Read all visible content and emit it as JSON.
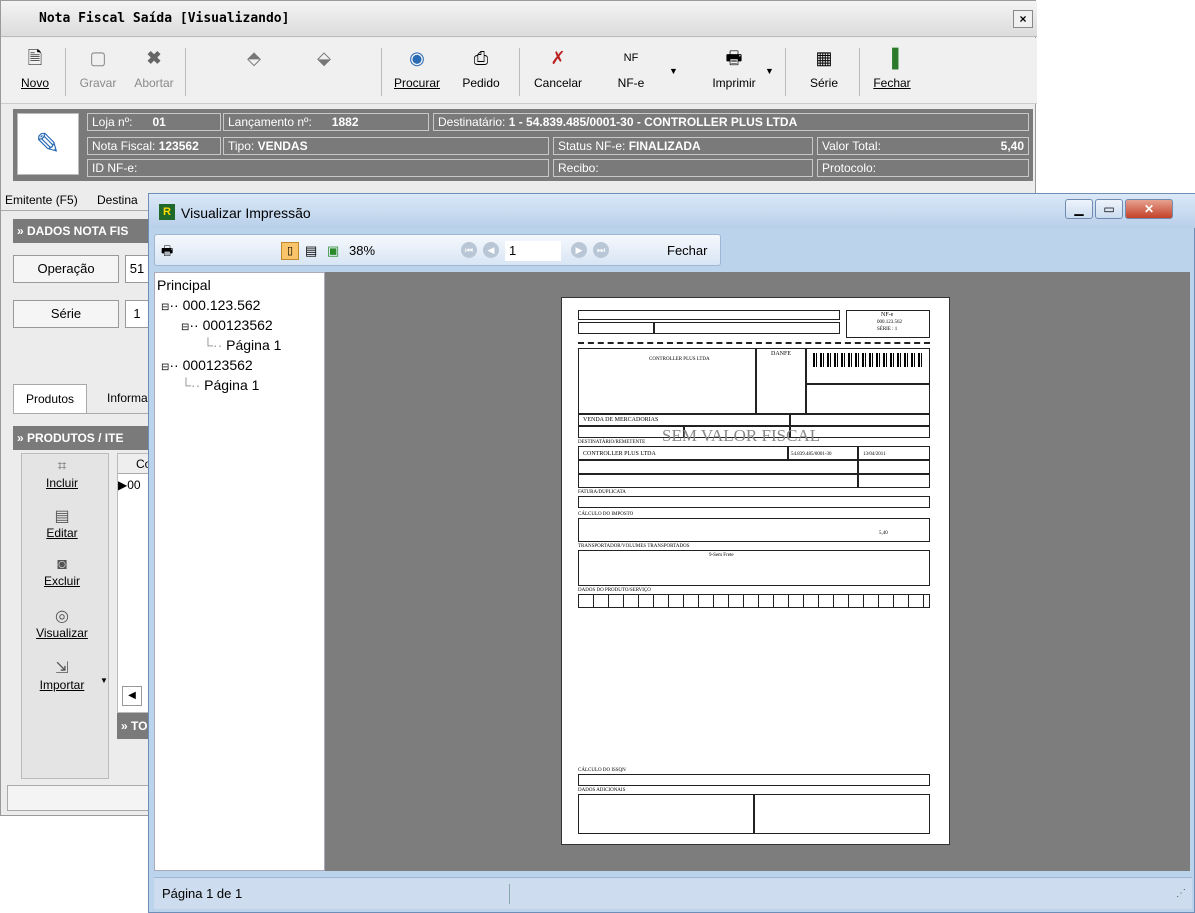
{
  "bg_window": {
    "title": "Nota Fiscal Saída [Visualizando]",
    "close": "×",
    "toolbar": {
      "novo": "Novo",
      "gravar": "Gravar",
      "abortar": "Abortar",
      "procurar": "Procurar",
      "pedido": "Pedido",
      "cancelar": "Cancelar",
      "nfe": "NF-e",
      "imprimir": "Imprimir",
      "serie": "Série",
      "fechar": "Fechar"
    },
    "header": {
      "loja_label": "Loja nº:",
      "loja_value": "01",
      "lanc_label": "Lançamento nº:",
      "lanc_value": "1882",
      "dest_label": "Destinatário:",
      "dest_value": "1 - 54.839.485/0001-30 - CONTROLLER PLUS LTDA",
      "nota_label": "Nota Fiscal:",
      "nota_value": "123562",
      "tipo_label": "Tipo:",
      "tipo_value": "VENDAS",
      "status_label": "Status NF-e:",
      "status_value": "FINALIZADA",
      "valor_label": "Valor Total:",
      "valor_value": "5,40",
      "idnfe_label": "ID NF-e:",
      "recibo_label": "Recibo:",
      "protocolo_label": "Protocolo:"
    },
    "tabs": [
      "Emitente (F5)",
      "Destina"
    ],
    "dados_title": "» DADOS NOTA FIS",
    "operacao": "Operação",
    "operacao_val": "51",
    "serie": "Série",
    "serie_val": "1",
    "subtabs": [
      "Produtos",
      "Informa"
    ],
    "produtos_title": "» PRODUTOS / ITE",
    "actions": {
      "incluir": "Incluir",
      "editar": "Editar",
      "excluir": "Excluir",
      "visualizar": "Visualizar",
      "importar": "Importar"
    },
    "grid_col": "Co",
    "grid_row": "00",
    "totals_title": "» TO"
  },
  "preview_window": {
    "title": "Visualizar Impressão",
    "zoom": "38%",
    "page_num": "1",
    "close_label": "Fechar",
    "tree": [
      "Principal",
      "000.123.562",
      "000123562",
      "Página 1",
      "000123562",
      "Página 1"
    ],
    "status": "Página 1 de 1",
    "document": {
      "watermark": "SEM VALOR FISCAL",
      "danfe": "DANFE",
      "nfe_label": "NF-e",
      "nfe_number": "000.123.562",
      "serie": "SÉRIE : 1",
      "emit_name": "CONTROLLER PLUS LTDA",
      "natureza": "VENDA DE MERCADORIAS",
      "dest_name": "CONTROLLER PLUS LTDA",
      "section_dest": "DESTINATÁRIO/REMETENTE",
      "section_fatura": "FATURA/DUPLICATA",
      "section_imposto": "CÁLCULO DO IMPOSTO",
      "section_transp": "TRANSPORTADOR/VOLUMES TRANSPORTADOS",
      "section_produtos": "DADOS DO PRODUTO/SERVIÇO",
      "section_issqn": "CÁLCULO DO ISSQN",
      "section_adicionais": "DADOS ADICIONAIS",
      "frete": "9-Sem Frete",
      "cnpj": "54.839.485/0001-30",
      "date": "13/04/2011",
      "valor_total": "5,40"
    }
  }
}
